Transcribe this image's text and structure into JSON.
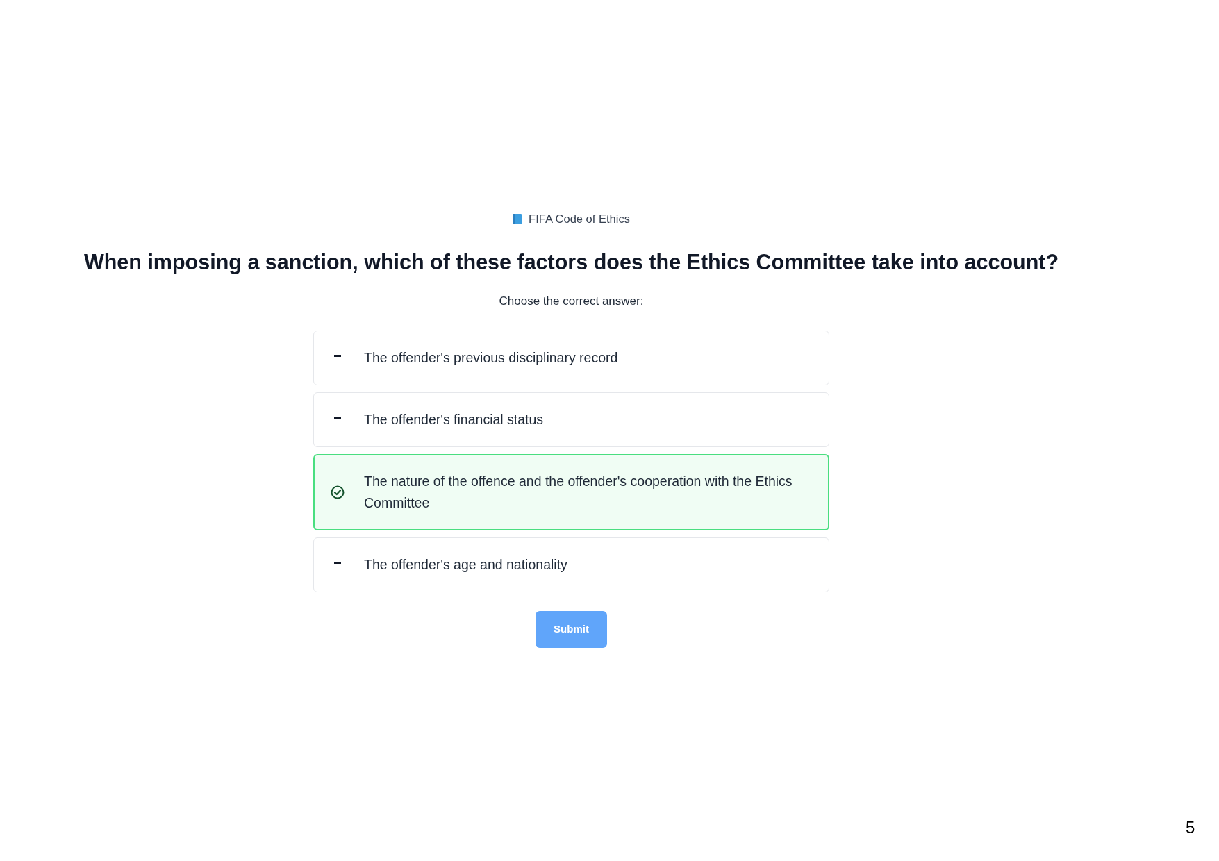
{
  "header": {
    "source": "FIFA Code of Ethics"
  },
  "question": "When imposing a sanction, which of these factors does the Ethics Committee take into account?",
  "instruction": "Choose the correct answer:",
  "options": [
    {
      "label": "The offender's previous disciplinary record",
      "selected": false
    },
    {
      "label": "The offender's financial status",
      "selected": false
    },
    {
      "label": "The nature of the offence and the offender's cooperation with the Ethics Committee",
      "selected": true
    },
    {
      "label": "The offender's age and nationality",
      "selected": false
    }
  ],
  "submit_button": "Submit",
  "page_number": "5"
}
